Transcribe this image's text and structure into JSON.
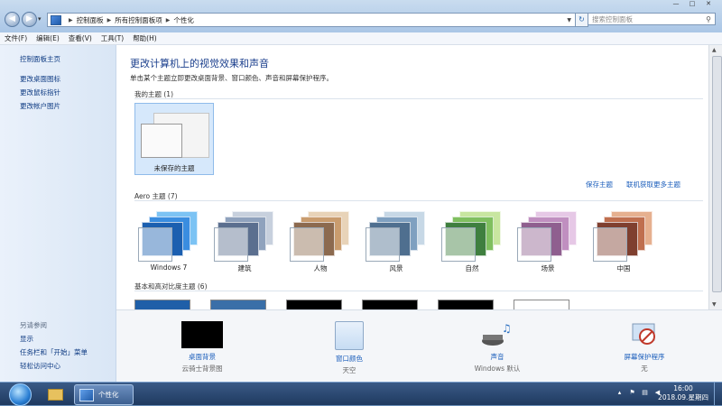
{
  "address": {
    "crumbs": [
      "控制面板",
      "所有控制面板项",
      "个性化"
    ],
    "search_placeholder": "搜索控制面板"
  },
  "menu": [
    "文件(F)",
    "编辑(E)",
    "查看(V)",
    "工具(T)",
    "帮助(H)"
  ],
  "sidebar": {
    "links": [
      "控制面板主页",
      "更改桌面图标",
      "更改鼠标指针",
      "更改帐户图片"
    ],
    "see_also_heading": "另请参阅",
    "see_also": [
      "显示",
      "任务栏和「开始」菜单",
      "轻松访问中心"
    ]
  },
  "main": {
    "title": "更改计算机上的视觉效果和声音",
    "subtitle": "单击某个主题立即更改桌面背景、窗口颜色、声音和屏幕保护程序。",
    "my_themes": {
      "heading": "我的主题 (1)",
      "items": [
        {
          "label": "未保存的主题"
        }
      ]
    },
    "save_link": "保存主题",
    "online_link": "联机获取更多主题",
    "aero": {
      "heading": "Aero 主题 (7)",
      "items": [
        {
          "label": "Windows 7",
          "colors": [
            "#1b5fb0",
            "#3a8de0",
            "#7cc3f4"
          ]
        },
        {
          "label": "建筑",
          "colors": [
            "#5b6f8f",
            "#8fa2bd",
            "#c7d0dd"
          ]
        },
        {
          "label": "人物",
          "colors": [
            "#8c6a4f",
            "#c99c6e",
            "#e8d3b8"
          ]
        },
        {
          "label": "风景",
          "colors": [
            "#4f6f8f",
            "#7fa0c0",
            "#c7d8e6"
          ]
        },
        {
          "label": "自然",
          "colors": [
            "#3f7f3f",
            "#7fbf5f",
            "#c8e6a0"
          ]
        },
        {
          "label": "场景",
          "colors": [
            "#8f5f8f",
            "#c08fc0",
            "#e6c8e6"
          ]
        },
        {
          "label": "中国",
          "colors": [
            "#7f3f2f",
            "#bf6f4f",
            "#e6b08f"
          ]
        }
      ]
    },
    "basic": {
      "heading": "基本和高对比度主题 (6)",
      "swatches": [
        "#1f5fa8",
        "#3a6fa8",
        "#000000",
        "#000000",
        "#000000",
        "#ffffff"
      ]
    }
  },
  "bottom": [
    {
      "label": "桌面背景",
      "value": "云骑士背景图"
    },
    {
      "label": "窗口颜色",
      "value": "天空"
    },
    {
      "label": "声音",
      "value": "Windows 默认"
    },
    {
      "label": "屏幕保护程序",
      "value": "无"
    }
  ],
  "taskbar": {
    "active_window": "个性化",
    "time": "16:00",
    "date": "2018.09.星期四"
  }
}
